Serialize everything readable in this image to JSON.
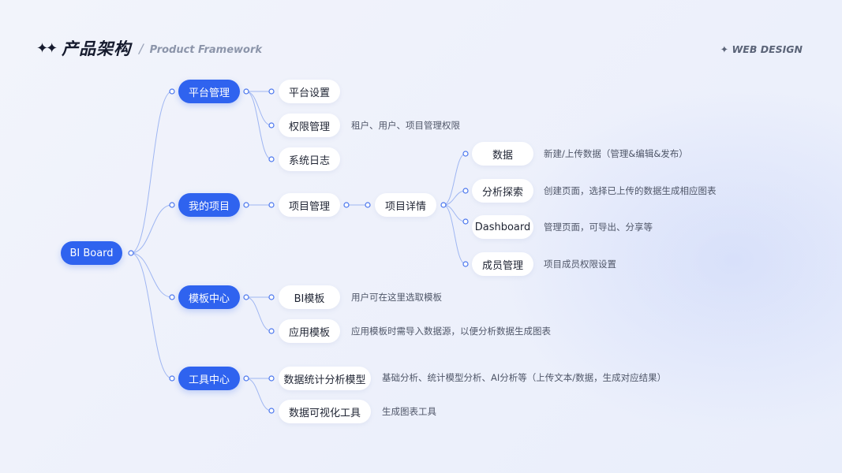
{
  "header": {
    "sparkle": "✦✦",
    "title": "产品架构",
    "slash": "/",
    "subtitle": "Product Framework",
    "brand": "✦ WEB DESIGN"
  },
  "root": {
    "label": "BI Board"
  },
  "level1": [
    {
      "key": "platform",
      "label": "平台管理"
    },
    {
      "key": "projects",
      "label": "我的项目"
    },
    {
      "key": "templates",
      "label": "模板中心"
    },
    {
      "key": "tools",
      "label": "工具中心"
    }
  ],
  "platform_children": [
    {
      "label": "平台设置",
      "desc": ""
    },
    {
      "label": "权限管理",
      "desc": "租户、用户、项目管理权限"
    },
    {
      "label": "系统日志",
      "desc": ""
    }
  ],
  "projects_children": [
    {
      "label": "项目管理"
    }
  ],
  "project_detail": {
    "label": "项目详情"
  },
  "project_detail_children": [
    {
      "label": "数据",
      "desc": "新建/上传数据（管理&编辑&发布）"
    },
    {
      "label": "分析探索",
      "desc": "创建页面，选择已上传的数据生成相应图表"
    },
    {
      "label": "Dashboard",
      "desc": "管理页面，可导出、分享等"
    },
    {
      "label": "成员管理",
      "desc": "项目成员权限设置"
    }
  ],
  "templates_children": [
    {
      "label": "BI模板",
      "desc": "用户可在这里选取模板"
    },
    {
      "label": "应用模板",
      "desc": "应用模板时需导入数据源，以便分析数据生成图表"
    }
  ],
  "tools_children": [
    {
      "label": "数据统计分析模型",
      "desc": "基础分析、统计模型分析、AI分析等（上传文本/数据，生成对应结果）"
    },
    {
      "label": "数据可视化工具",
      "desc": "生成图表工具"
    }
  ],
  "colors": {
    "accent": "#2f63ef",
    "connector": "#9fb6f2",
    "node_white": "#ffffff",
    "text_dark": "#151a2d"
  }
}
